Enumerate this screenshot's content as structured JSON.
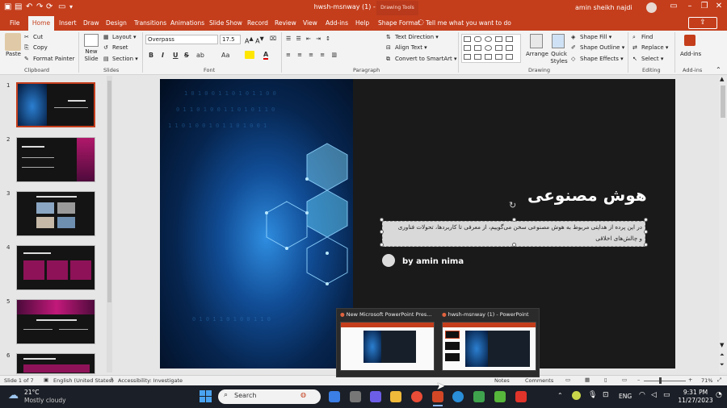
{
  "titlebar": {
    "app_title": "hwsh-msnway (1)  -  PowerPoint",
    "drawing_tools": "Drawing Tools",
    "user": "amin sheikh najdi"
  },
  "tabs": [
    "File",
    "Home",
    "Insert",
    "Draw",
    "Design",
    "Transitions",
    "Animations",
    "Slide Show",
    "Record",
    "Review",
    "View",
    "Add-ins",
    "Help",
    "Shape Format"
  ],
  "tellme": "Tell me what you want to do",
  "ribbon": {
    "clipboard": {
      "paste": "Paste",
      "cut": "Cut",
      "copy": "Copy",
      "format_painter": "Format Painter",
      "label": "Clipboard"
    },
    "slides": {
      "new_slide": "New Slide",
      "layout": "Layout",
      "reset": "Reset",
      "section": "Section",
      "label": "Slides"
    },
    "font": {
      "name": "Overpass",
      "size": "17.5",
      "label": "Font",
      "bold": "B",
      "italic": "I",
      "underline": "U",
      "strike": "S",
      "abc": "ab",
      "aa": "Aa",
      "color": "A"
    },
    "paragraph": {
      "text_direction": "Text Direction",
      "align_text": "Align Text",
      "smartart": "Convert to SmartArt",
      "label": "Paragraph"
    },
    "drawing": {
      "arrange": "Arrange",
      "quick_styles": "Quick Styles",
      "shape_fill": "Shape Fill",
      "shape_outline": "Shape Outline",
      "shape_effects": "Shape Effects",
      "label": "Drawing"
    },
    "editing": {
      "find": "Find",
      "replace": "Replace",
      "select": "Select",
      "label": "Editing"
    },
    "addins": {
      "addins": "Add-ins",
      "label": "Add-ins"
    }
  },
  "thumbnails": [
    "1",
    "2",
    "3",
    "4",
    "5",
    "6"
  ],
  "slide": {
    "title": "هوش مصنوعی",
    "body_line1": "در این پرده از هدایتی مربوط به هوش مصنوعی سخن می‌گوییم، از معرفی تا کاربردها، تحولات فناوری",
    "body_line2": "و چالش‌های اخلاقی",
    "author": "by amin nima"
  },
  "status": {
    "slide_of": "Slide 1 of 7",
    "language": "English (United States)",
    "accessibility": "Accessibility: Investigate",
    "notes": "Notes",
    "comments": "Comments",
    "zoom": "71%"
  },
  "previews": [
    {
      "title": "New Microsoft PowerPoint Pres..."
    },
    {
      "title": "hwsh-msnway (1) - PowerPoint"
    }
  ],
  "taskbar": {
    "weather_temp": "21°C",
    "weather_desc": "Mostly cloudy",
    "search": "Search",
    "lang": "ENG",
    "time": "9:31 PM",
    "date": "11/27/2023"
  },
  "colors": {
    "accent": "#c43e1c",
    "slide_bg": "#1a1a1a",
    "taskbar": "#1b1f27"
  }
}
